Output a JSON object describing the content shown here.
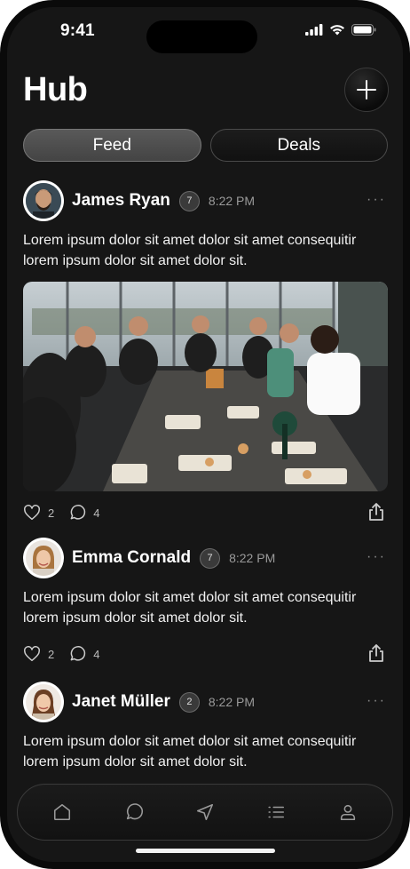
{
  "status_bar": {
    "time": "9:41"
  },
  "header": {
    "title": "Hub"
  },
  "tabs": [
    {
      "label": "Feed",
      "active": true
    },
    {
      "label": "Deals",
      "active": false
    }
  ],
  "posts": [
    {
      "name": "James Ryan",
      "badge": "7",
      "time": "8:22 PM",
      "text": "Lorem ipsum dolor sit amet dolor sit amet consequitir lorem  ipsum dolor sit amet dolor sit.",
      "likes": "2",
      "comments": "4",
      "has_photo": true
    },
    {
      "name": "Emma Cornald",
      "badge": "7",
      "time": "8:22 PM",
      "text": "Lorem ipsum dolor sit amet dolor sit amet consequitir lorem  ipsum dolor sit amet dolor sit.",
      "likes": "2",
      "comments": "4",
      "has_photo": false
    },
    {
      "name": "Janet Müller",
      "badge": "2",
      "time": "8:22 PM",
      "text": "Lorem ipsum dolor sit amet dolor sit amet consequitir lorem  ipsum dolor sit amet dolor sit.",
      "has_photo": false
    }
  ],
  "more_glyph": "···",
  "nav": [
    "home-icon",
    "chat-icon",
    "navigation-icon",
    "list-icon",
    "profile-icon"
  ]
}
